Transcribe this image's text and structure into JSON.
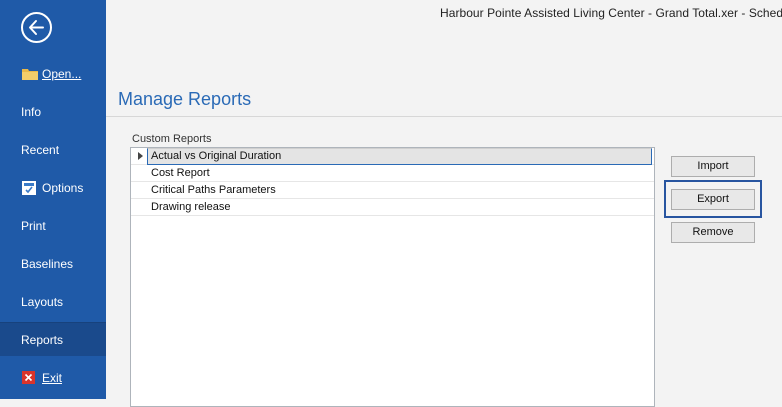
{
  "window": {
    "title": "Harbour Pointe Assisted Living Center - Grand Total.xer - ScheduleR"
  },
  "sidebar": {
    "items": [
      {
        "label": "Open...",
        "icon": "folder-icon"
      },
      {
        "label": "Info"
      },
      {
        "label": "Recent"
      },
      {
        "label": "Options",
        "icon": "options-icon"
      },
      {
        "label": "Print"
      },
      {
        "label": "Baselines"
      },
      {
        "label": "Layouts"
      },
      {
        "label": "Reports",
        "active": true
      },
      {
        "label": "Exit",
        "icon": "close-icon"
      }
    ],
    "colors": {
      "background": "#1f5aa8",
      "active": "#1a4a8c"
    }
  },
  "main": {
    "title": "Manage Reports",
    "section_label": "Custom Reports",
    "reports": [
      {
        "name": "Actual vs Original Duration",
        "selected": true
      },
      {
        "name": "Cost Report"
      },
      {
        "name": "Critical Paths Parameters"
      },
      {
        "name": "Drawing release"
      }
    ],
    "buttons": {
      "import": "Import",
      "export": "Export",
      "remove": "Remove"
    },
    "accent_color": "#2a6ab6"
  }
}
